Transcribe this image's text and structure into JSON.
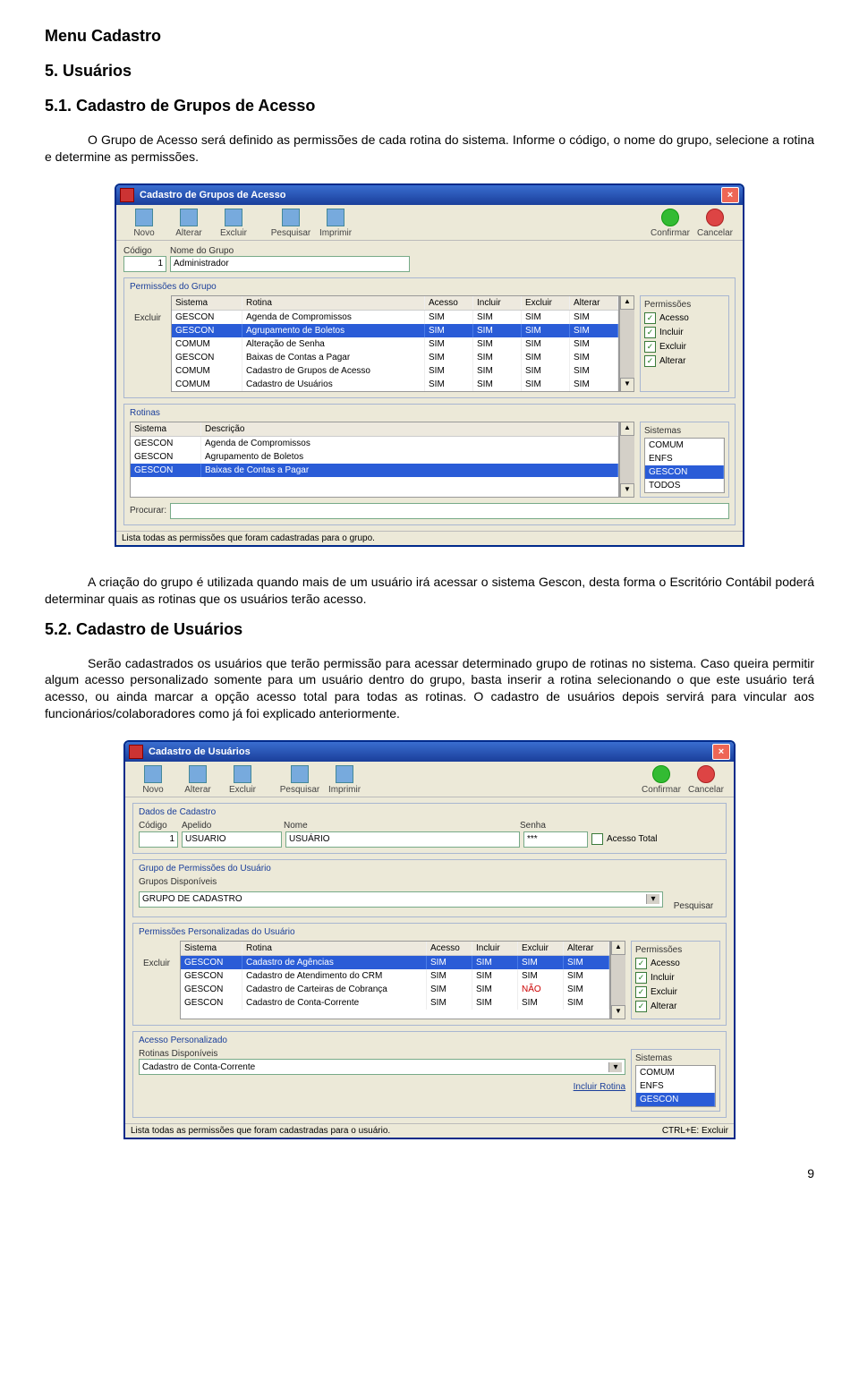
{
  "doc": {
    "h1": "Menu Cadastro",
    "h2": "5. Usuários",
    "h3a": "5.1. Cadastro de Grupos de Acesso",
    "p1": "O Grupo de Acesso será definido as permissões de cada rotina do sistema. Informe o código, o nome do grupo, selecione a rotina e determine as permissões.",
    "p2": "A criação do grupo é utilizada quando mais de um usuário irá  acessar o sistema Gescon, desta forma o Escritório Contábil poderá determinar quais as rotinas que os usuários terão acesso.",
    "h3b": "5.2. Cadastro de Usuários",
    "p3": "Serão cadastrados os usuários que terão permissão para acessar determinado grupo de rotinas no sistema. Caso queira permitir algum acesso personalizado somente para um usuário dentro do grupo, basta inserir a rotina selecionando o que este usuário terá acesso, ou ainda marcar a opção acesso total para todas as rotinas. O cadastro de usuários depois servirá para vincular aos funcionários/colaboradores como já foi explicado anteriormente.",
    "pageNum": "9"
  },
  "toolbar": {
    "novo": "Novo",
    "alterar": "Alterar",
    "excluir": "Excluir",
    "pesquisar": "Pesquisar",
    "imprimir": "Imprimir",
    "confirmar": "Confirmar",
    "cancelar": "Cancelar"
  },
  "win1": {
    "title": "Cadastro de Grupos de Acesso",
    "codigoLbl": "Código",
    "nomeLbl": "Nome do Grupo",
    "codigo": "1",
    "nome": "Administrador",
    "permGrupo": "Permissões do Grupo",
    "excluirSide": "Excluir",
    "cols": {
      "sistema": "Sistema",
      "rotina": "Rotina",
      "acesso": "Acesso",
      "incluir": "Incluir",
      "excluir": "Excluir",
      "alterar": "Alterar"
    },
    "rows": [
      {
        "s": "GESCON",
        "r": "Agenda de Compromissos",
        "a": "SIM",
        "i": "SIM",
        "e": "SIM",
        "al": "SIM",
        "sel": false
      },
      {
        "s": "GESCON",
        "r": "Agrupamento de Boletos",
        "a": "SIM",
        "i": "SIM",
        "e": "SIM",
        "al": "SIM",
        "sel": true
      },
      {
        "s": "COMUM",
        "r": "Alteração de Senha",
        "a": "SIM",
        "i": "SIM",
        "e": "SIM",
        "al": "SIM",
        "sel": false
      },
      {
        "s": "GESCON",
        "r": "Baixas de Contas a Pagar",
        "a": "SIM",
        "i": "SIM",
        "e": "SIM",
        "al": "SIM",
        "sel": false
      },
      {
        "s": "COMUM",
        "r": "Cadastro de Grupos de Acesso",
        "a": "SIM",
        "i": "SIM",
        "e": "SIM",
        "al": "SIM",
        "sel": false
      },
      {
        "s": "COMUM",
        "r": "Cadastro de Usuários",
        "a": "SIM",
        "i": "SIM",
        "e": "SIM",
        "al": "SIM",
        "sel": false
      }
    ],
    "permSide": {
      "title": "Permissões",
      "acesso": "Acesso",
      "incluir": "Incluir",
      "excluir": "Excluir",
      "alterar": "Alterar"
    },
    "rotinas": {
      "title": "Rotinas",
      "cols": {
        "sistema": "Sistema",
        "descricao": "Descrição"
      },
      "rows": [
        {
          "s": "GESCON",
          "d": "Agenda de Compromissos",
          "sel": false
        },
        {
          "s": "GESCON",
          "d": "Agrupamento de Boletos",
          "sel": false
        },
        {
          "s": "GESCON",
          "d": "Baixas de Contas a Pagar",
          "sel": true
        }
      ]
    },
    "sistemas": {
      "title": "Sistemas",
      "items": [
        "COMUM",
        "ENFS",
        "GESCON",
        "TODOS"
      ],
      "sel": "GESCON"
    },
    "procurar": "Procurar:",
    "status": "Lista todas as permissões que foram cadastradas para o grupo."
  },
  "win2": {
    "title": "Cadastro de Usuários",
    "dados": "Dados de Cadastro",
    "codigoLbl": "Código",
    "apelidoLbl": "Apelido",
    "nomeLbl": "Nome",
    "senhaLbl": "Senha",
    "codigo": "1",
    "apelido": "USUARIO",
    "nome": "USUÁRIO",
    "senha": "***",
    "acessoTotal": "Acesso Total",
    "grupoPerm": "Grupo de Permissões do Usuário",
    "gruposDisp": "Grupos Disponíveis",
    "grupoSel": "GRUPO DE CADASTRO",
    "pesquisar": "Pesquisar",
    "permPers": "Permissões Personalizadas do Usuário",
    "excluirSide": "Excluir",
    "cols": {
      "sistema": "Sistema",
      "rotina": "Rotina",
      "acesso": "Acesso",
      "incluir": "Incluir",
      "excluir": "Excluir",
      "alterar": "Alterar"
    },
    "rows": [
      {
        "s": "GESCON",
        "r": "Cadastro de Agências",
        "a": "SIM",
        "i": "SIM",
        "e": "SIM",
        "al": "SIM",
        "sel": true,
        "eRed": false
      },
      {
        "s": "GESCON",
        "r": "Cadastro de Atendimento do CRM",
        "a": "SIM",
        "i": "SIM",
        "e": "SIM",
        "al": "SIM",
        "sel": false,
        "eRed": false
      },
      {
        "s": "GESCON",
        "r": "Cadastro de Carteiras de Cobrança",
        "a": "SIM",
        "i": "SIM",
        "e": "NÃO",
        "al": "SIM",
        "sel": false,
        "eRed": true
      },
      {
        "s": "GESCON",
        "r": "Cadastro de Conta-Corrente",
        "a": "SIM",
        "i": "SIM",
        "e": "SIM",
        "al": "SIM",
        "sel": false,
        "eRed": false
      }
    ],
    "permSide": {
      "title": "Permissões",
      "acesso": "Acesso",
      "incluir": "Incluir",
      "excluir": "Excluir",
      "alterar": "Alterar"
    },
    "acessoPers": "Acesso Personalizado",
    "rotDisp": "Rotinas Disponíveis",
    "rotSel": "Cadastro de Conta-Corrente",
    "incluirRotina": "Incluir Rotina",
    "sistemas": {
      "title": "Sistemas",
      "items": [
        "COMUM",
        "ENFS",
        "GESCON"
      ],
      "sel": "GESCON"
    },
    "status": "Lista todas as permissões que foram cadastradas para o usuário.",
    "statusRight": "CTRL+E: Excluir"
  }
}
